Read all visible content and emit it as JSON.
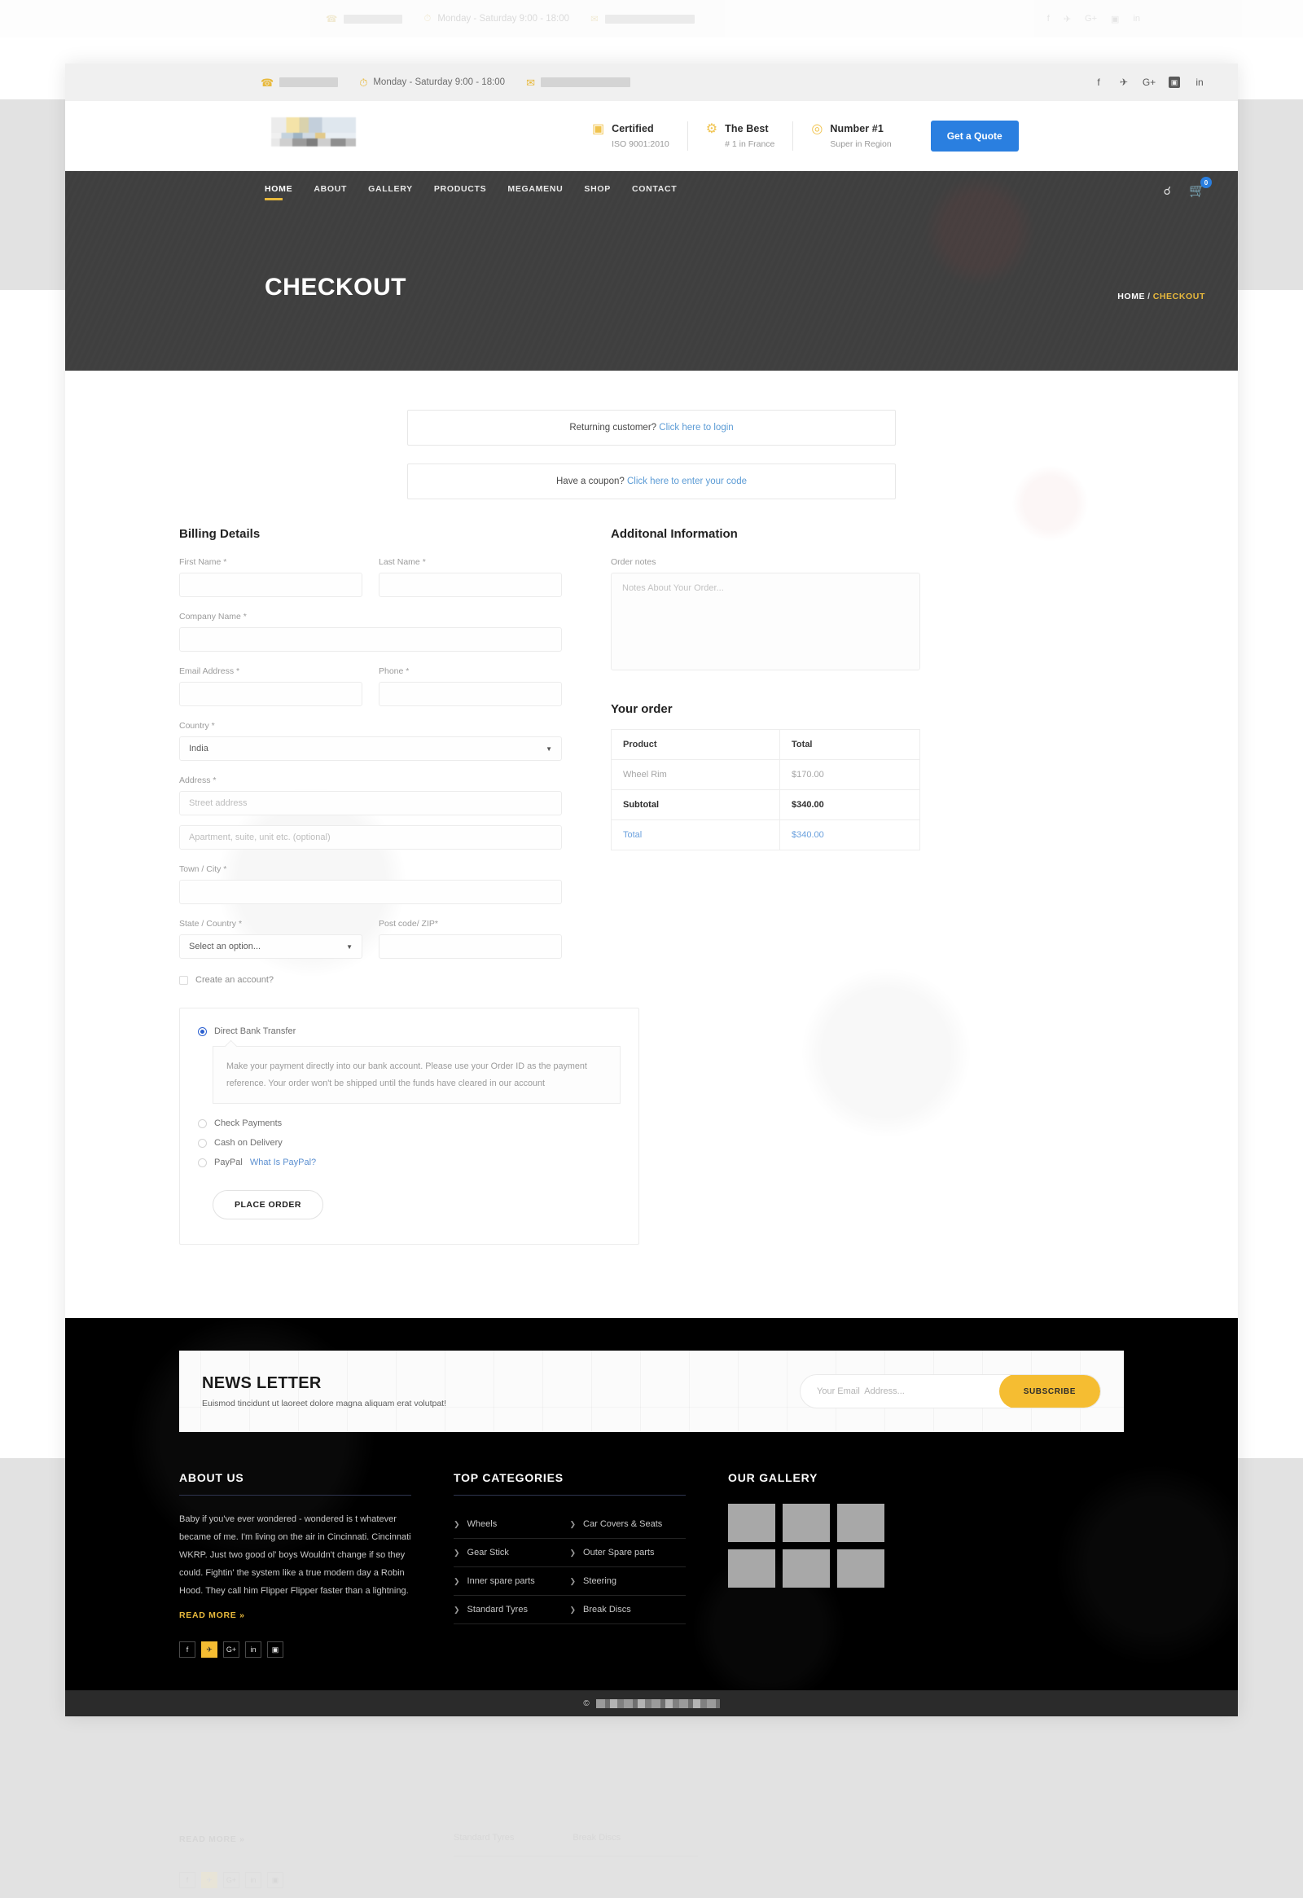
{
  "topbar": {
    "hours": "Monday - Saturday 9:00 - 18:00",
    "phone_redacted": "",
    "email_redacted": "",
    "socials": [
      {
        "name": "facebook-icon",
        "glyph": "f"
      },
      {
        "name": "twitter-icon",
        "glyph": "✈"
      },
      {
        "name": "google-plus-icon",
        "glyph": "G+"
      },
      {
        "name": "instagram-icon",
        "glyph": "▣"
      },
      {
        "name": "linkedin-icon",
        "glyph": "in"
      }
    ]
  },
  "masthead": {
    "badges": [
      {
        "icon": "certificate-icon",
        "title": "Certified",
        "sub": "ISO 9001:2010"
      },
      {
        "icon": "gear-icon",
        "title": "The Best",
        "sub": "# 1 in France"
      },
      {
        "icon": "medal-icon",
        "title": "Number #1",
        "sub": "Super in Region"
      }
    ],
    "quote_label": "Get a Quote",
    "quote_color": "#2a7fe0"
  },
  "nav": {
    "items": [
      {
        "label": "HOME",
        "active": true
      },
      {
        "label": "ABOUT",
        "active": false
      },
      {
        "label": "GALLERY",
        "active": false
      },
      {
        "label": "PRODUCTS",
        "active": false
      },
      {
        "label": "MEGAMENU",
        "active": false
      },
      {
        "label": "SHOP",
        "active": false
      },
      {
        "label": "CONTACT",
        "active": false
      }
    ],
    "cart_count": "0",
    "accent": "#e8b93c"
  },
  "hero": {
    "title": "CHECKOUT",
    "crumb_home": "HOME",
    "crumb_sep": "/",
    "crumb_current": "CHECKOUT"
  },
  "notices": {
    "login_text": "Returning customer?",
    "login_link": "Click here to login",
    "coupon_text": "Have a coupon?",
    "coupon_link": "Click here to enter your code"
  },
  "billing": {
    "heading": "Billing Details",
    "first_name_label": "First Name *",
    "last_name_label": "Last Name *",
    "company_label": "Company Name *",
    "email_label": "Email Address *",
    "phone_label": "Phone *",
    "country_label": "Country *",
    "country_value": "India",
    "address_label": "Address *",
    "street_placeholder": "Street address",
    "apartment_placeholder": "Apartment, suite, unit etc. (optional)",
    "town_label": "Town / City *",
    "state_label": "State / Country *",
    "state_value": "Select an option...",
    "zip_label": "Post code/ ZIP*",
    "create_account_label": "Create an account?"
  },
  "payment": {
    "options": [
      {
        "label": "Direct Bank Transfer",
        "selected": true
      },
      {
        "label": "Check Payments",
        "selected": false
      },
      {
        "label": "Cash on Delivery",
        "selected": false
      },
      {
        "label": "PayPal",
        "selected": false,
        "link": "What Is PayPal?"
      }
    ],
    "description": "Make your payment directly into our bank account. Please use your Order ID as the payment reference. Your order won't be shipped until the funds have cleared in our account",
    "place_order_label": "PLACE ORDER"
  },
  "additional": {
    "heading": "Additonal Information",
    "notes_label": "Order notes",
    "notes_placeholder": "Notes About Your Order..."
  },
  "order": {
    "heading": "Your order",
    "columns": [
      "Product",
      "Total"
    ],
    "rows": [
      {
        "label": "Wheel Rim",
        "value": "$170.00",
        "kind": "prod"
      },
      {
        "label": "Subtotal",
        "value": "$340.00",
        "kind": "sub"
      },
      {
        "label": "Total",
        "value": "$340.00",
        "kind": "tot"
      }
    ]
  },
  "newsletter": {
    "title": "NEWS LETTER",
    "subtitle": "Euismod tincidunt ut laoreet dolore magna aliquam erat volutpat!",
    "placeholder": "Your Email  Address...",
    "button": "SUBSCRIBE",
    "button_color": "#f5bd32"
  },
  "footer": {
    "about_heading": "ABOUT US",
    "about_body": "Baby if you've ever wondered - wondered is t whatever became of me. I'm living on the air in Cincinnati. Cincinnati WKRP. Just two good ol' boys Wouldn't change if so they could. Fightin' the system like a true modern day a Robin Hood. They call him Flipper Flipper faster than a lightning.",
    "read_more": "READ MORE",
    "read_more_arrow": "»",
    "socials": [
      {
        "name": "facebook-icon",
        "glyph": "f",
        "highlight": false
      },
      {
        "name": "twitter-icon",
        "glyph": "✈",
        "highlight": true
      },
      {
        "name": "google-plus-icon",
        "glyph": "G+",
        "highlight": false
      },
      {
        "name": "linkedin-icon",
        "glyph": "in",
        "highlight": false
      },
      {
        "name": "instagram-icon",
        "glyph": "▣",
        "highlight": false
      }
    ],
    "categories_heading": "TOP CATEGORIES",
    "categories": [
      "Wheels",
      "Car Covers & Seats",
      "Gear Stick",
      "Outer Spare parts",
      "Inner spare parts",
      "Steering",
      "Standard Tyres",
      "Break Discs"
    ],
    "gallery_heading": "OUR GALLERY",
    "gallery_cells": 6,
    "copyright_redacted": ""
  }
}
